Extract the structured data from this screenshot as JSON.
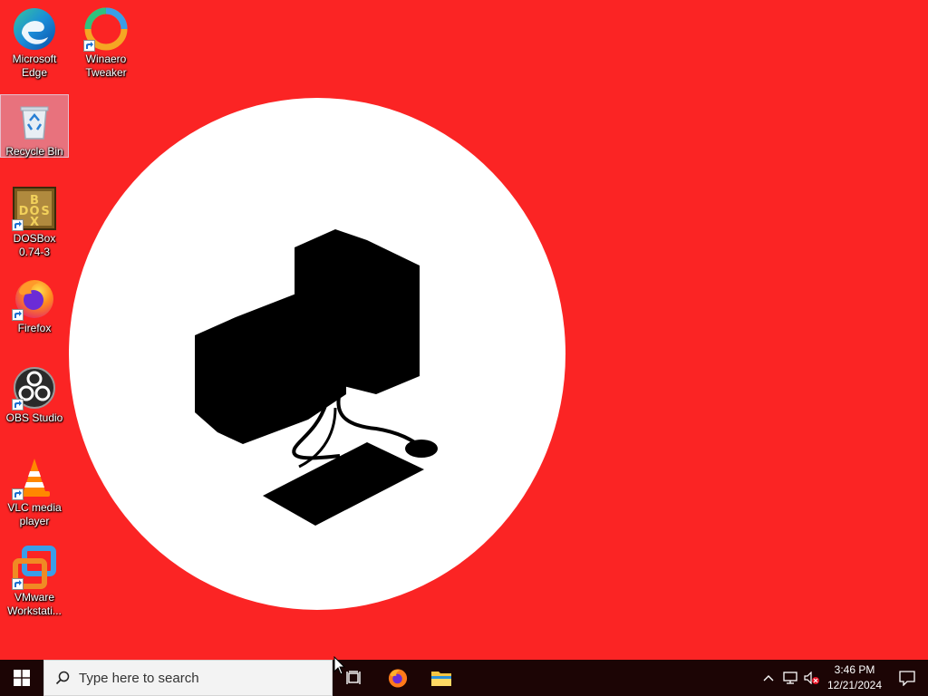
{
  "colors": {
    "wallpaper_bg": "#fb2424",
    "wallpaper_circle": "#ffffff",
    "taskbar_bg": "#1c0505",
    "accent_blue": "#1a8cd8"
  },
  "desktop": {
    "icons": [
      {
        "label": "Microsoft Edge",
        "icon": "edge-icon",
        "shortcut": false,
        "selected": false
      },
      {
        "label": "Winaero Tweaker",
        "icon": "winaero-tweaker-icon",
        "shortcut": true,
        "selected": false
      },
      {
        "label": "Recycle Bin",
        "icon": "recycle-bin-icon",
        "shortcut": false,
        "selected": true
      },
      {
        "label": "DOSBox 0.74-3",
        "icon": "dosbox-icon",
        "shortcut": true,
        "selected": false
      },
      {
        "label": "Firefox",
        "icon": "firefox-icon",
        "shortcut": true,
        "selected": false
      },
      {
        "label": "OBS Studio",
        "icon": "obs-studio-icon",
        "shortcut": true,
        "selected": false
      },
      {
        "label": "VLC media player",
        "icon": "vlc-icon",
        "shortcut": true,
        "selected": false
      },
      {
        "label": "VMware Workstati...",
        "icon": "vmware-icon",
        "shortcut": true,
        "selected": false
      }
    ],
    "wallpaper": {
      "art": "computer-monitor-keyboard-illustration"
    }
  },
  "taskbar": {
    "start_icon": "windows-logo-icon",
    "search": {
      "placeholder": "Type here to search",
      "icon": "search-icon"
    },
    "task_view_icon": "task-view-icon",
    "pinned": [
      {
        "name": "Firefox",
        "icon": "firefox-icon"
      },
      {
        "name": "File Explorer",
        "icon": "folder-icon"
      }
    ],
    "tray": {
      "icons": [
        "chevron-up-icon",
        "network-icon",
        "volume-muted-icon"
      ],
      "time": "3:46 PM",
      "date": "12/21/2024",
      "notification_icon": "notification-icon"
    }
  }
}
